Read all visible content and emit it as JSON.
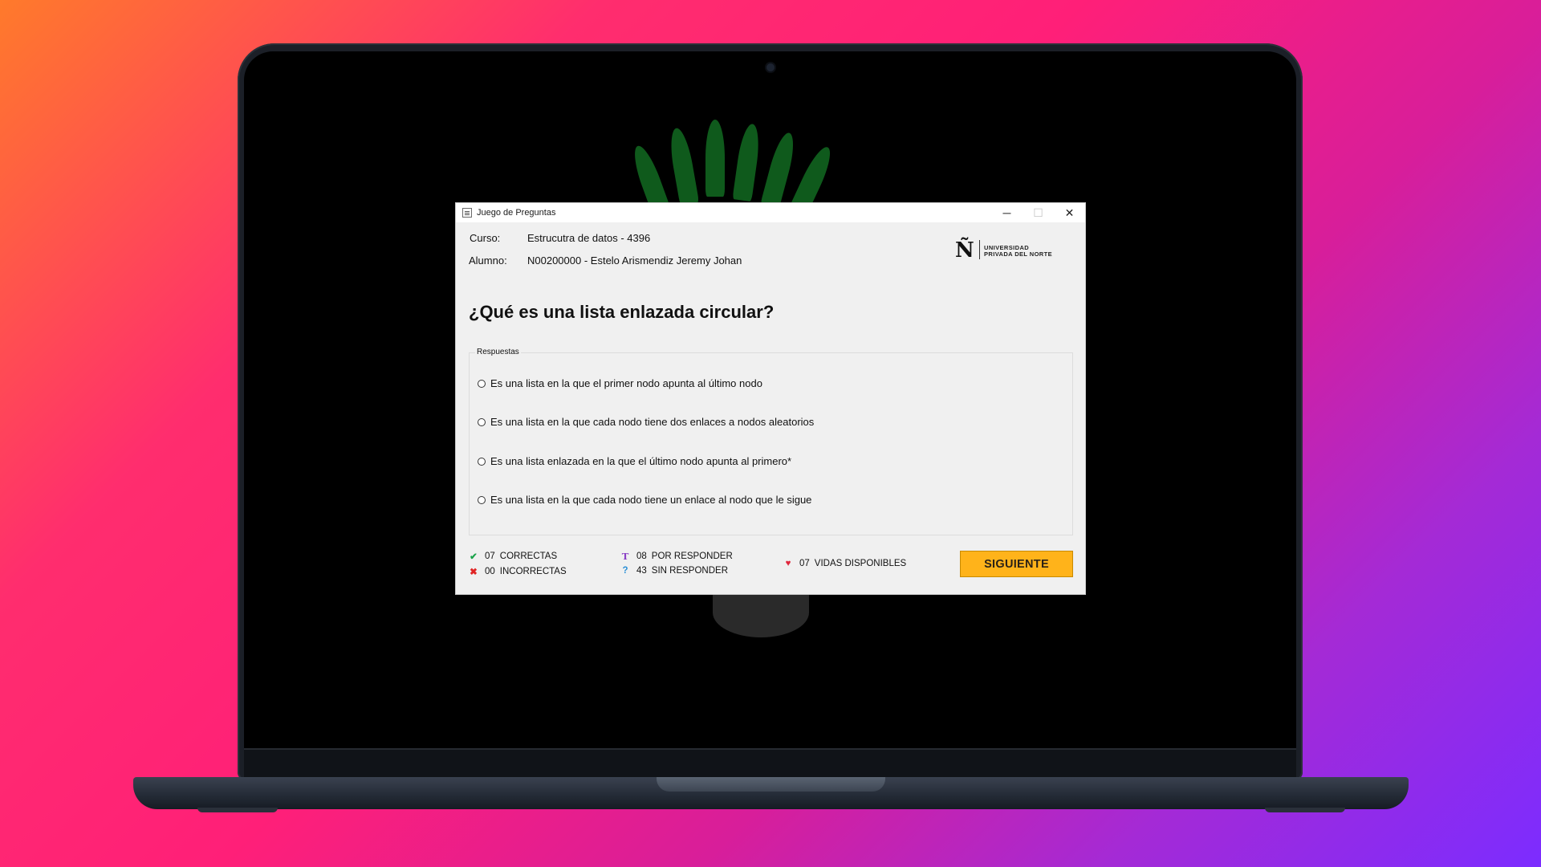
{
  "window": {
    "title": "Juego de Preguntas",
    "controls": {
      "minimize": "─",
      "maximize": "☐",
      "close": "✕"
    }
  },
  "info": {
    "course_label": "Curso:",
    "course_value": "Estrucutra de datos - 4396",
    "student_label": "Alumno:",
    "student_value": "N00200000 - Estelo Arismendiz Jeremy Johan"
  },
  "logo": {
    "letter": "Ñ",
    "line1": "UNIVERSIDAD",
    "line2": "PRIVADA DEL NORTE"
  },
  "question": "¿Qué es una lista enlazada circular?",
  "answers": {
    "legend": "Respuestas",
    "options": [
      "Es una lista en la que el primer nodo apunta al último nodo",
      "Es una lista en la que cada nodo tiene dos enlaces a nodos aleatorios",
      "Es una lista enlazada en la que el último nodo apunta al primero*",
      "Es una lista en la que cada nodo tiene un enlace al nodo que le sigue"
    ]
  },
  "stats": {
    "correct": {
      "icon": "check-icon",
      "count": "07",
      "label": "CORRECTAS",
      "color": "#1aa34a"
    },
    "incorrect": {
      "icon": "x-icon",
      "count": "00",
      "label": "INCORRECTAS",
      "color": "#e02424"
    },
    "pending": {
      "icon": "t-icon",
      "count": "08",
      "label": "POR RESPONDER",
      "color": "#8a3fc6"
    },
    "unanswered": {
      "icon": "question-icon",
      "count": "43",
      "label": "SIN RESPONDER",
      "color": "#2a8fd6"
    },
    "lives": {
      "icon": "heart-icon",
      "count": "07",
      "label": "VIDAS DISPONIBLES",
      "color": "#e0263c"
    }
  },
  "next_button": "SIGUIENTE"
}
